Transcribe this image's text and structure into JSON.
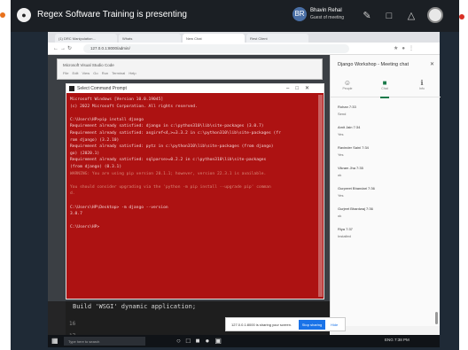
{
  "teams": {
    "title": "Regex Software Training is presenting",
    "presenter_name": "Bhavin Rehal",
    "presenter_role": "Guest of meeting",
    "presenter_initials": "BR"
  },
  "browser": {
    "tabs": [
      "(1) DRC Manipulation…",
      "Whats",
      "New Chat",
      "Rest Client"
    ],
    "url": "127.0.0.1:8000/admin/"
  },
  "inner_window": {
    "title": "Microsoft Visual Studio Code",
    "menu": "File  Edit  View  Go  Run  Terminal  Help"
  },
  "cmd": {
    "title": "Select Command Prompt",
    "lines": [
      {
        "t": "Microsoft Windows [Version 10.0.19045]",
        "dim": false
      },
      {
        "t": "(c) 2022 Microsoft Corporation. All rights reserved.",
        "dim": false
      },
      {
        "t": "",
        "dim": false
      },
      {
        "t": "C:\\Users\\HP>pip install django",
        "dim": false
      },
      {
        "t": "Requirement already satisfied: django in c:\\python310\\lib\\site-packages (3.0.7)",
        "dim": false
      },
      {
        "t": "Requirement already satisfied: asgiref<4,>=3.3.2 in c:\\python310\\lib\\site-packages (fr",
        "dim": false
      },
      {
        "t": "rom django) (3.2.10)",
        "dim": false
      },
      {
        "t": "Requirement already satisfied: pytz in c:\\python310\\lib\\site-packages (from django)",
        "dim": false
      },
      {
        "t": "go) (2020.1)",
        "dim": false
      },
      {
        "t": "Requirement already satisfied: sqlparse>=0.2.2 in c:\\python310\\lib\\site-packages",
        "dim": false
      },
      {
        "t": " (from django) (0.3.1)",
        "dim": false
      },
      {
        "t": "WARNING: You are using pip version 20.1.1; however, version 22.3.1 is available.",
        "dim": true
      },
      {
        "t": "",
        "dim": false
      },
      {
        "t": "You should consider upgrading via the 'python -m pip install --upgrade pip' comman",
        "dim": true
      },
      {
        "t": "d.",
        "dim": true
      },
      {
        "t": "",
        "dim": false
      },
      {
        "t": "C:\\Users\\HP\\Desktop> -m django --version",
        "dim": false
      },
      {
        "t": "3.0.7",
        "dim": false
      },
      {
        "t": "",
        "dim": false
      },
      {
        "t": "C:\\Users\\HP>",
        "dim": false
      }
    ]
  },
  "vscode": {
    "code": "    Build 'WSGI' dynamic application;",
    "line_numbers": [
      "15",
      "16",
      "17"
    ]
  },
  "panel": {
    "header": "Django Workshop - Meeting chat",
    "tabs": [
      {
        "icon": "☺",
        "label": "People"
      },
      {
        "icon": "■",
        "label": "Chat"
      },
      {
        "icon": "ℹ",
        "label": "Info"
      }
    ],
    "messages": [
      {
        "name": "Rohan 7:33",
        "text": "Send"
      },
      {
        "name": "Amit Jain 7:34",
        "text": "Yes"
      },
      {
        "name": "Ravinder Saini 7:34",
        "text": "Yes"
      },
      {
        "name": "Vikram Jha 7:35",
        "text": "ok"
      },
      {
        "name": "Gurpreet Bhandari 7:36",
        "text": "Yes"
      },
      {
        "name": "Gurjeet Bhardwaj 7:36",
        "text": "ok"
      },
      {
        "name": "Riya 7:37",
        "text": "Installed"
      }
    ]
  },
  "toast": {
    "text": "127.0.0.1:8000 is sharing your screen.",
    "stop": "Stop sharing",
    "hide": "Hide"
  },
  "taskbar": {
    "search": "Type here to search",
    "tray": "ENG 7:38 PM"
  }
}
